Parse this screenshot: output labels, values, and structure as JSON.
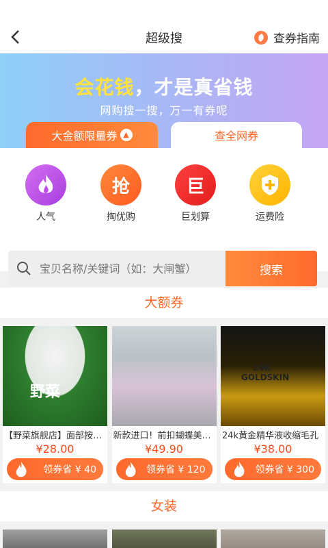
{
  "navbar": {
    "title": "超级搜",
    "guide_label": "查券指南"
  },
  "banner": {
    "slogan_yellow": "会花钱",
    "slogan_white": "，才是真省钱",
    "subtitle": "网购搜一搜，万一有券呢",
    "tab_active": "大金额限量券",
    "tab_inactive": "查全网券"
  },
  "categories": [
    {
      "label": "人气",
      "glyph": ""
    },
    {
      "label": "掏优购",
      "glyph": "抢"
    },
    {
      "label": "巨划算",
      "glyph": "巨"
    },
    {
      "label": "运费险",
      "glyph": "+"
    }
  ],
  "search": {
    "placeholder": "宝贝名称/关键词（如：大闸蟹）",
    "button": "搜索"
  },
  "sections": {
    "big_coupon": "大额券",
    "womens": "女装"
  },
  "products": [
    {
      "name": "【野菜旗舰店】面部按摩膏",
      "price": "¥28.00",
      "coupon": "领券省 ¥ 40",
      "img_text": "野菜"
    },
    {
      "name": "新款进口！前扣蝴蝶美背文胸",
      "price": "¥49.90",
      "coupon": "领券省 ¥ 120",
      "img_text": ""
    },
    {
      "name": "24k黄金精华液收缩毛孔",
      "price": "¥38.00",
      "coupon": "领券省 ¥ 300",
      "img_text": "24K GOLDSKIN"
    }
  ]
}
